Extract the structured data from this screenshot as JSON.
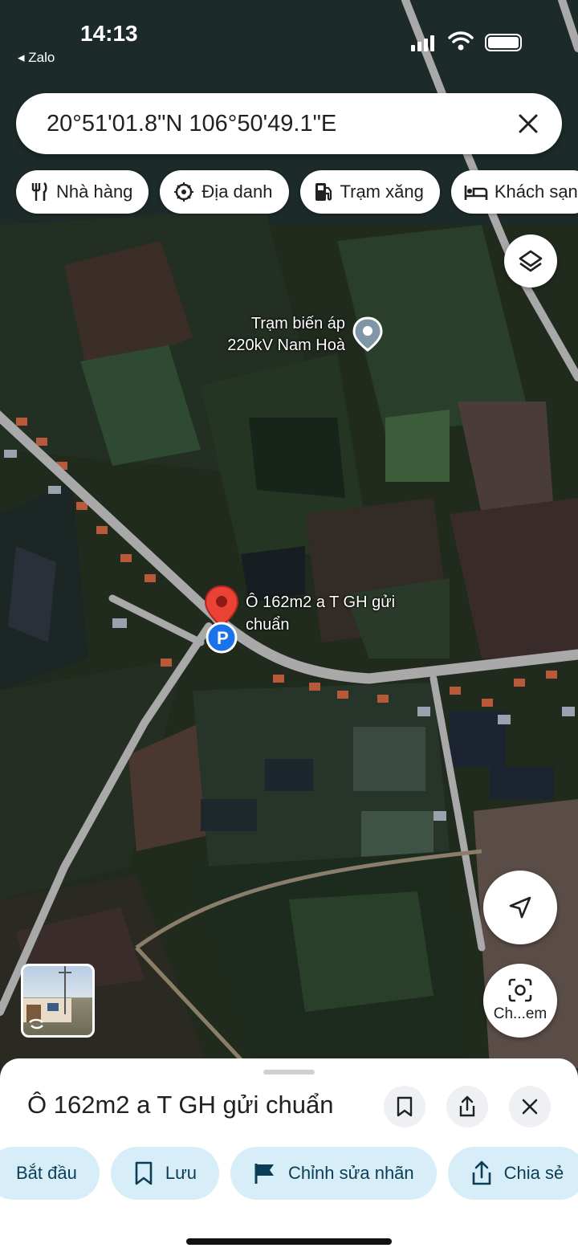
{
  "status_bar": {
    "time": "14:13",
    "back_app": "◂ Zalo"
  },
  "search": {
    "query": "20°51'01.8\"N 106°50'49.1\"E"
  },
  "category_chips": [
    {
      "label": "Nhà hàng",
      "icon": "restaurant-icon"
    },
    {
      "label": "Địa danh",
      "icon": "landmark-icon"
    },
    {
      "label": "Trạm xăng",
      "icon": "gas-station-icon"
    },
    {
      "label": "Khách sạn",
      "icon": "hotel-icon"
    }
  ],
  "map": {
    "type": "satellite",
    "poi": {
      "name_line1": "Trạm biến áp",
      "name_line2": "220kV Nam Hoà",
      "icon": "place-pin-icon"
    },
    "pin": {
      "label_line1": "Ô 162m2 a T GH gửi",
      "label_line2": "chuẩn",
      "icon": "parking-pin-icon"
    },
    "lens_label": "Ch...em"
  },
  "place_sheet": {
    "title": "Ô 162m2 a T GH gửi chuẩn",
    "actions": [
      {
        "label": "Bắt đầu",
        "icon": ""
      },
      {
        "label": "Lưu",
        "icon": "bookmark-icon"
      },
      {
        "label": "Chỉnh sửa nhãn",
        "icon": "flag-icon"
      },
      {
        "label": "Chia sẻ",
        "icon": "share-icon"
      }
    ]
  },
  "colors": {
    "action_bg": "#d7eef8",
    "action_text": "#0b3e56",
    "pin_red": "#ea4335",
    "parking_blue": "#1a73e8"
  }
}
